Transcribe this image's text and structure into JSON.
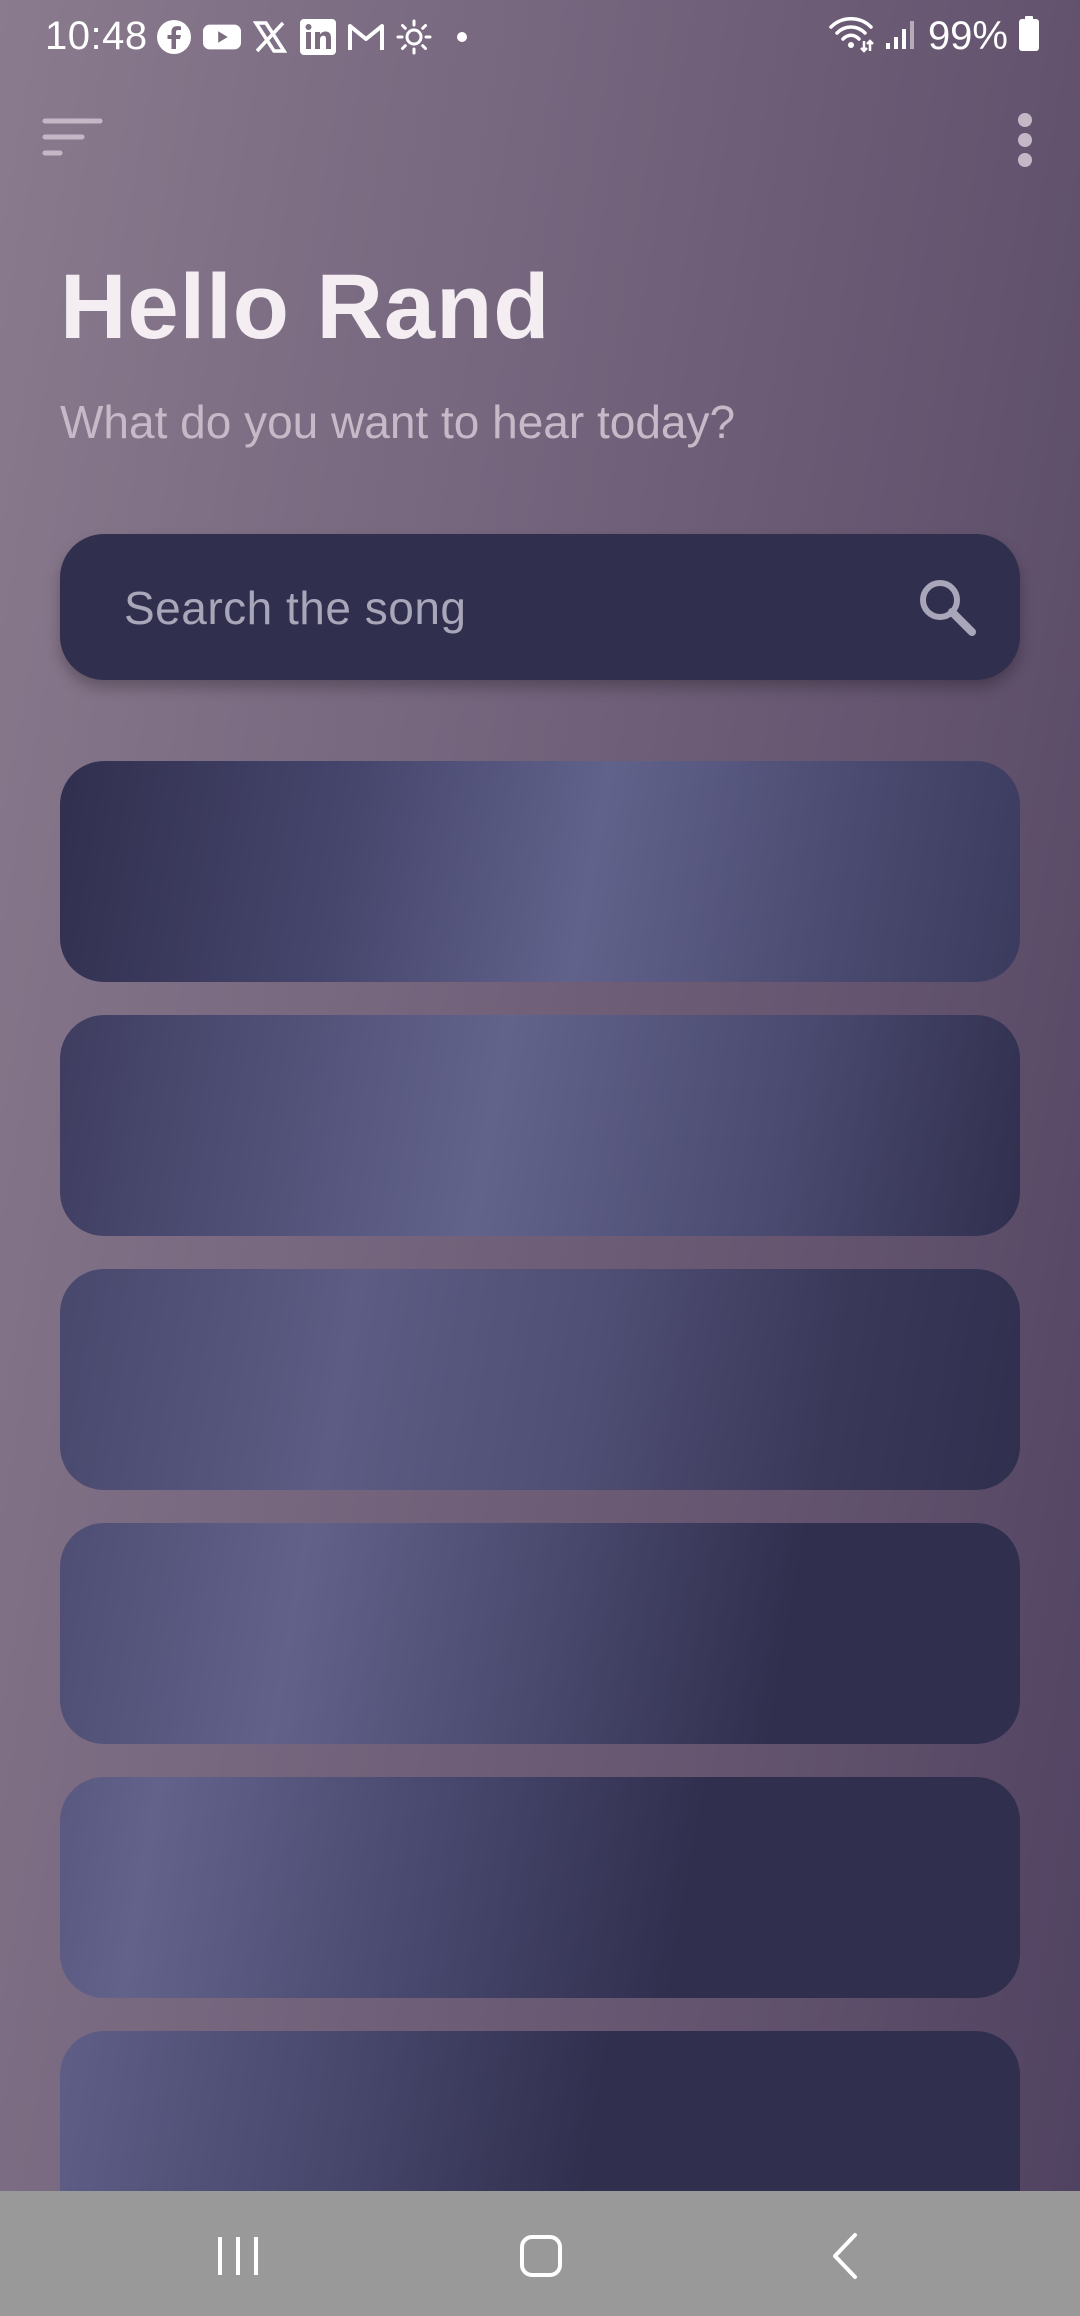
{
  "status_bar": {
    "time": "10:48",
    "notification_icons": [
      "facebook-icon",
      "youtube-icon",
      "x-icon",
      "linkedin-icon",
      "gmail-icon",
      "brightness-icon",
      "dot-icon"
    ],
    "battery": "99%"
  },
  "header": {
    "greeting": "Hello Rand",
    "subtitle": "What do you want to hear today?"
  },
  "search": {
    "placeholder": "Search the song",
    "value": ""
  },
  "song_cards": [
    {
      "state": "loading"
    },
    {
      "state": "loading"
    },
    {
      "state": "loading"
    },
    {
      "state": "loading"
    },
    {
      "state": "loading"
    },
    {
      "state": "loading"
    }
  ],
  "colors": {
    "background_start": "#8b7b8e",
    "background_end": "#4f4260",
    "card": "#302f4e",
    "shimmer": "#62638b",
    "greeting": "#f4eef3",
    "subtitle": "#c7b9c8",
    "nav_bar": "#999999"
  }
}
